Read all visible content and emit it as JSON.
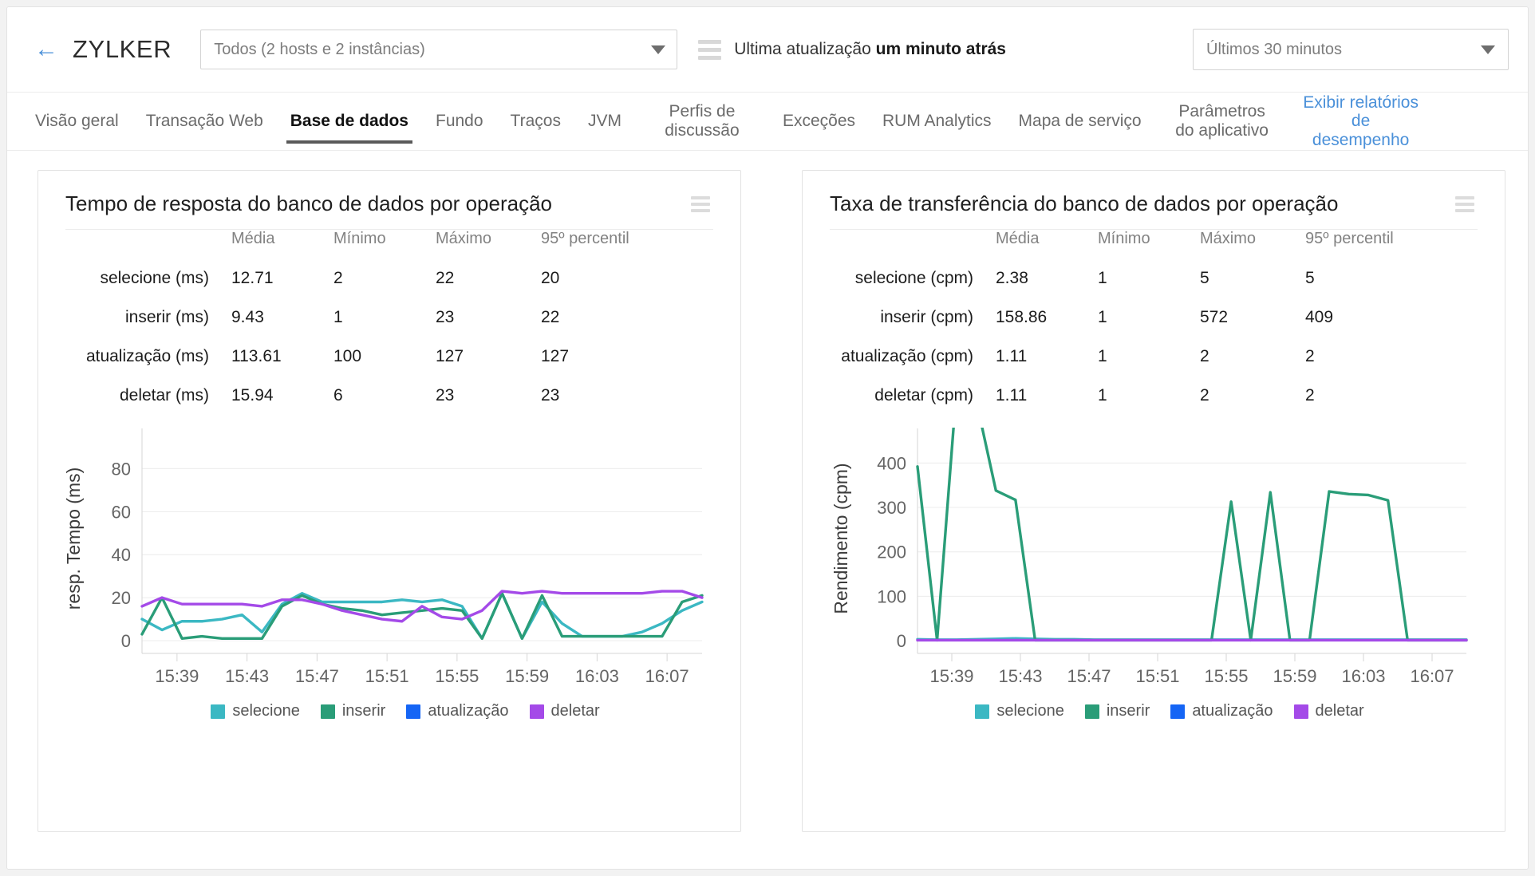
{
  "header": {
    "back_icon": "arrow-left-icon",
    "brand": "ZYLKER",
    "host_filter": {
      "value": "Todos (2 hosts e 2 instâncias)",
      "caret_icon": "chevron-down-icon"
    },
    "menu_icon": "hamburger-icon",
    "update_prefix": "Ultima atualização ",
    "update_value": "um minuto atrás",
    "time_range": {
      "value": "Últimos 30 minutos",
      "caret_icon": "chevron-down-icon"
    }
  },
  "tabs": [
    {
      "label": "Visão geral",
      "active": false,
      "link": false
    },
    {
      "label": "Transação Web",
      "active": false,
      "link": false
    },
    {
      "label": "Base de dados",
      "active": true,
      "link": false
    },
    {
      "label": "Fundo",
      "active": false,
      "link": false
    },
    {
      "label": "Traços",
      "active": false,
      "link": false
    },
    {
      "label": "JVM",
      "active": false,
      "link": false
    },
    {
      "label": "Perfis de discussão",
      "active": false,
      "link": false
    },
    {
      "label": "Exceções",
      "active": false,
      "link": false
    },
    {
      "label": "RUM Analytics",
      "active": false,
      "link": false
    },
    {
      "label": "Mapa de serviço",
      "active": false,
      "link": false
    },
    {
      "label": "Parâmetros do aplicativo",
      "active": false,
      "link": false
    },
    {
      "label": "Exibir relatórios de desempenho",
      "active": false,
      "link": true
    }
  ],
  "cards": [
    {
      "title": "Tempo de resposta do banco de dados por operação",
      "menu_icon": "card-menu-icon",
      "table": {
        "columns": [
          "Média",
          "Mínimo",
          "Máximo",
          "95º percentil"
        ],
        "rows": [
          {
            "label": "selecione (ms)",
            "values": [
              "12.71",
              "2",
              "22",
              "20"
            ]
          },
          {
            "label": "inserir (ms)",
            "values": [
              "9.43",
              "1",
              "23",
              "22"
            ]
          },
          {
            "label": "atualização (ms)",
            "values": [
              "113.61",
              "100",
              "127",
              "127"
            ]
          },
          {
            "label": "deletar (ms)",
            "values": [
              "15.94",
              "6",
              "23",
              "23"
            ]
          }
        ]
      },
      "legend": [
        {
          "label": "selecione",
          "color": "#3bb8c3"
        },
        {
          "label": "inserir",
          "color": "#2a9d78"
        },
        {
          "label": "atualização",
          "color": "#1565f5"
        },
        {
          "label": "deletar",
          "color": "#a44ae8"
        }
      ]
    },
    {
      "title": "Taxa de transferência do banco de dados por operação",
      "menu_icon": "card-menu-icon",
      "table": {
        "columns": [
          "Média",
          "Mínimo",
          "Máximo",
          "95º percentil"
        ],
        "rows": [
          {
            "label": "selecione  (cpm)",
            "values": [
              "2.38",
              "1",
              "5",
              "5"
            ]
          },
          {
            "label": "inserir  (cpm)",
            "values": [
              "158.86",
              "1",
              "572",
              "409"
            ]
          },
          {
            "label": "atualização  (cpm)",
            "values": [
              "1.11",
              "1",
              "2",
              "2"
            ]
          },
          {
            "label": "deletar  (cpm)",
            "values": [
              "1.11",
              "1",
              "2",
              "2"
            ]
          }
        ]
      },
      "legend": [
        {
          "label": "selecione",
          "color": "#3bb8c3"
        },
        {
          "label": "inserir",
          "color": "#2a9d78"
        },
        {
          "label": "atualização",
          "color": "#1565f5"
        },
        {
          "label": "deletar",
          "color": "#a44ae8"
        }
      ]
    }
  ],
  "chart_data": [
    {
      "type": "line",
      "title": "Tempo de resposta do banco de dados por operação",
      "xlabel": "",
      "ylabel": "resp. Tempo (ms)",
      "ylim": [
        0,
        95
      ],
      "yticks": [
        0,
        20,
        40,
        60,
        80
      ],
      "grid": true,
      "legend_position": "bottom",
      "xtick_labels": [
        "15:39",
        "15:43",
        "15:47",
        "15:51",
        "15:55",
        "15:59",
        "16:03",
        "16:07"
      ],
      "x": [
        0,
        1,
        2,
        3,
        4,
        5,
        6,
        7,
        8,
        9,
        10,
        11,
        12,
        13,
        14,
        15,
        16,
        17,
        18,
        19,
        20,
        21,
        22,
        23,
        24,
        25,
        26,
        27,
        28
      ],
      "series": [
        {
          "name": "selecione",
          "color": "#3bb8c3",
          "values": [
            10,
            5,
            9,
            9,
            10,
            12,
            4,
            17,
            22,
            18,
            18,
            18,
            18,
            19,
            18,
            19,
            16,
            1,
            22,
            1,
            18,
            8,
            2,
            2,
            2,
            4,
            8,
            14,
            18
          ]
        },
        {
          "name": "inserir",
          "color": "#2a9d78",
          "values": [
            3,
            20,
            1,
            2,
            1,
            1,
            1,
            16,
            21,
            17,
            15,
            14,
            12,
            13,
            14,
            15,
            14,
            1,
            22,
            1,
            21,
            2,
            2,
            2,
            2,
            2,
            2,
            18,
            21
          ]
        },
        {
          "name": "atualização",
          "color": "#1565f5",
          "values": [
            null,
            null,
            null,
            null,
            null,
            null,
            null,
            null,
            null,
            null,
            null,
            null,
            null,
            null,
            null,
            null,
            null,
            null,
            null,
            null,
            null,
            null,
            null,
            null,
            null,
            null,
            null,
            null,
            null
          ]
        },
        {
          "name": "deletar",
          "color": "#a44ae8",
          "values": [
            16,
            20,
            17,
            17,
            17,
            17,
            16,
            19,
            19,
            17,
            14,
            12,
            10,
            9,
            16,
            11,
            10,
            14,
            23,
            22,
            23,
            22,
            22,
            22,
            22,
            22,
            23,
            23,
            20
          ]
        }
      ]
    },
    {
      "type": "line",
      "title": "Taxa de transferência do banco de dados por operação",
      "xlabel": "",
      "ylabel": "Rendimento (cpm)",
      "ylim": [
        0,
        460
      ],
      "yticks": [
        0,
        100,
        200,
        300,
        400
      ],
      "grid": true,
      "legend_position": "bottom",
      "xtick_labels": [
        "15:39",
        "15:43",
        "15:47",
        "15:51",
        "15:55",
        "15:59",
        "16:03",
        "16:07"
      ],
      "x": [
        0,
        1,
        2,
        3,
        4,
        5,
        6,
        7,
        8,
        9,
        10,
        11,
        12,
        13,
        14,
        15,
        16,
        17,
        18,
        19,
        20,
        21,
        22,
        23,
        24,
        25,
        26,
        27,
        28
      ],
      "series": [
        {
          "name": "selecione",
          "color": "#3bb8c3",
          "values": [
            3,
            2,
            2,
            3,
            4,
            5,
            4,
            3,
            3,
            2,
            2,
            2,
            2,
            2,
            2,
            2,
            2,
            2,
            2,
            2,
            2,
            2,
            2,
            2,
            2,
            2,
            2,
            2,
            2
          ]
        },
        {
          "name": "inserir",
          "color": "#2a9d78",
          "values": [
            392,
            1,
            572,
            540,
            338,
            317,
            1,
            1,
            1,
            1,
            1,
            1,
            1,
            1,
            1,
            1,
            313,
            1,
            334,
            1,
            1,
            336,
            330,
            328,
            316,
            1,
            1,
            1,
            1
          ]
        },
        {
          "name": "atualização",
          "color": "#1565f5",
          "values": [
            null,
            null,
            null,
            null,
            null,
            null,
            null,
            null,
            null,
            null,
            null,
            null,
            null,
            null,
            null,
            null,
            null,
            null,
            null,
            null,
            null,
            null,
            null,
            null,
            null,
            null,
            null,
            null,
            null
          ]
        },
        {
          "name": "deletar",
          "color": "#a44ae8",
          "values": [
            1,
            1,
            1,
            1,
            1,
            1,
            1,
            1,
            1,
            1,
            1,
            1,
            1,
            1,
            1,
            1,
            1,
            1,
            1,
            1,
            1,
            1,
            1,
            1,
            1,
            1,
            1,
            1,
            1
          ]
        }
      ]
    }
  ]
}
